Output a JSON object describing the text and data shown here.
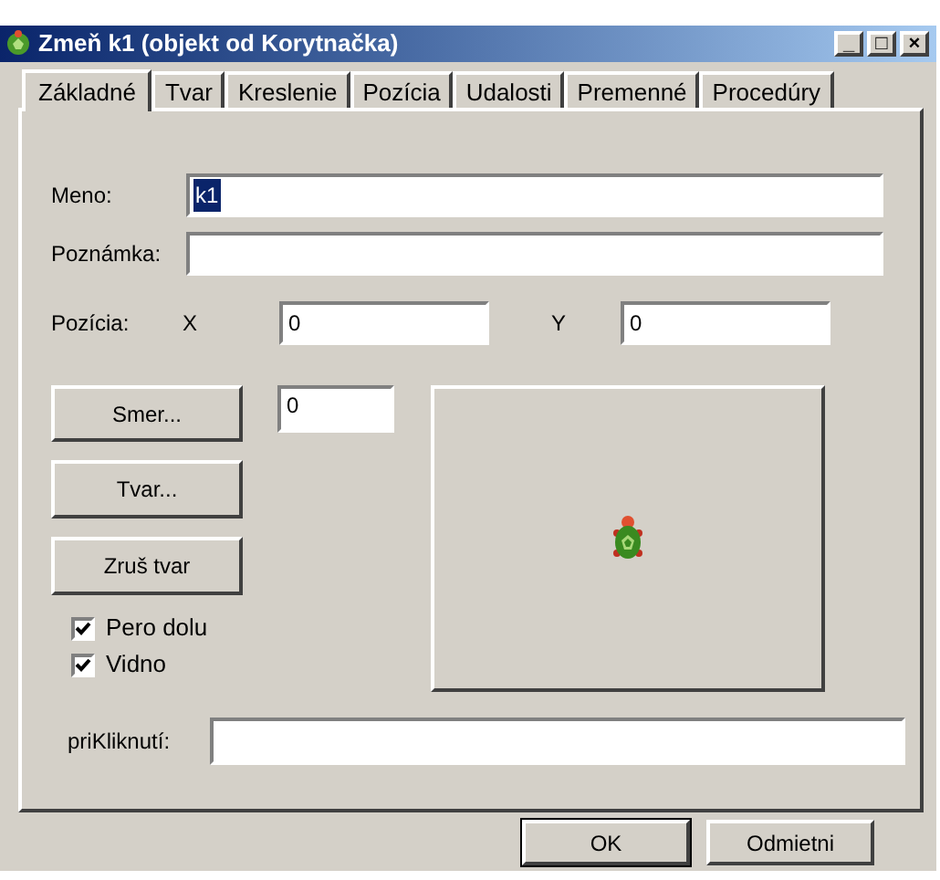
{
  "window": {
    "title": "Zmeň k1 (objekt od Korytnačka)",
    "controls": [
      "_",
      "□",
      "×"
    ]
  },
  "tabs": [
    {
      "label": "Základné",
      "selected": true
    },
    {
      "label": "Tvar",
      "selected": false
    },
    {
      "label": "Kreslenie",
      "selected": false
    },
    {
      "label": "Pozícia",
      "selected": false
    },
    {
      "label": "Udalosti",
      "selected": false
    },
    {
      "label": "Premenné",
      "selected": false
    },
    {
      "label": "Procedúry",
      "selected": false
    }
  ],
  "name": {
    "label": "Meno:",
    "value": "k1",
    "highlighted": true
  },
  "note": {
    "label": "Poznámka:"
  },
  "position": {
    "label": "Pozícia:",
    "x_label": "X",
    "x_value": "0",
    "y_label": "Y",
    "y_value": "0"
  },
  "direction": {
    "button": "Smer...",
    "value": "0"
  },
  "shape_buttons": [
    "Tvar...",
    "Zruš tvar"
  ],
  "checkboxes": [
    {
      "label": "Pero dolu",
      "checked": true
    },
    {
      "label": "Vidno",
      "checked": true
    }
  ],
  "on_click": {
    "label": "priKliknutí:"
  },
  "dialog_buttons": [
    {
      "label": "OK",
      "default": true
    },
    {
      "label": "Odmietni",
      "default": false
    }
  ]
}
